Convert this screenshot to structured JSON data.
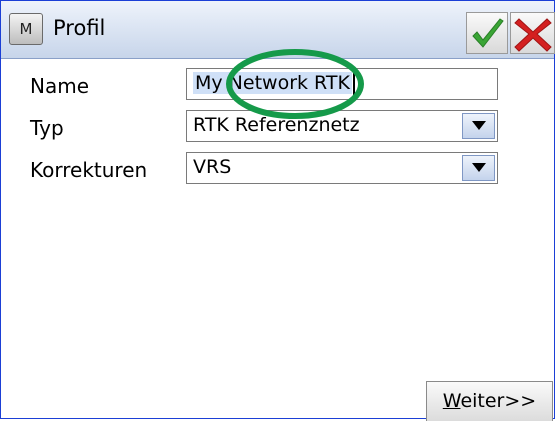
{
  "titlebar": {
    "menu_glyph": "M",
    "title": "Profil",
    "ok_icon": "checkmark-icon",
    "cancel_icon": "close-x-icon",
    "ok_color": "#3aa535",
    "cancel_color": "#d42020"
  },
  "form": {
    "name_label": "Name",
    "name_value_sel": "My Network RTK",
    "typ_label": "Typ",
    "typ_value": "RTK Referenznetz",
    "korrekturen_label": "Korrekturen",
    "korrekturen_value": "VRS"
  },
  "annotation": {
    "color": "#159a4a"
  },
  "footer": {
    "next_underlined": "W",
    "next_rest": "eiter>>"
  }
}
